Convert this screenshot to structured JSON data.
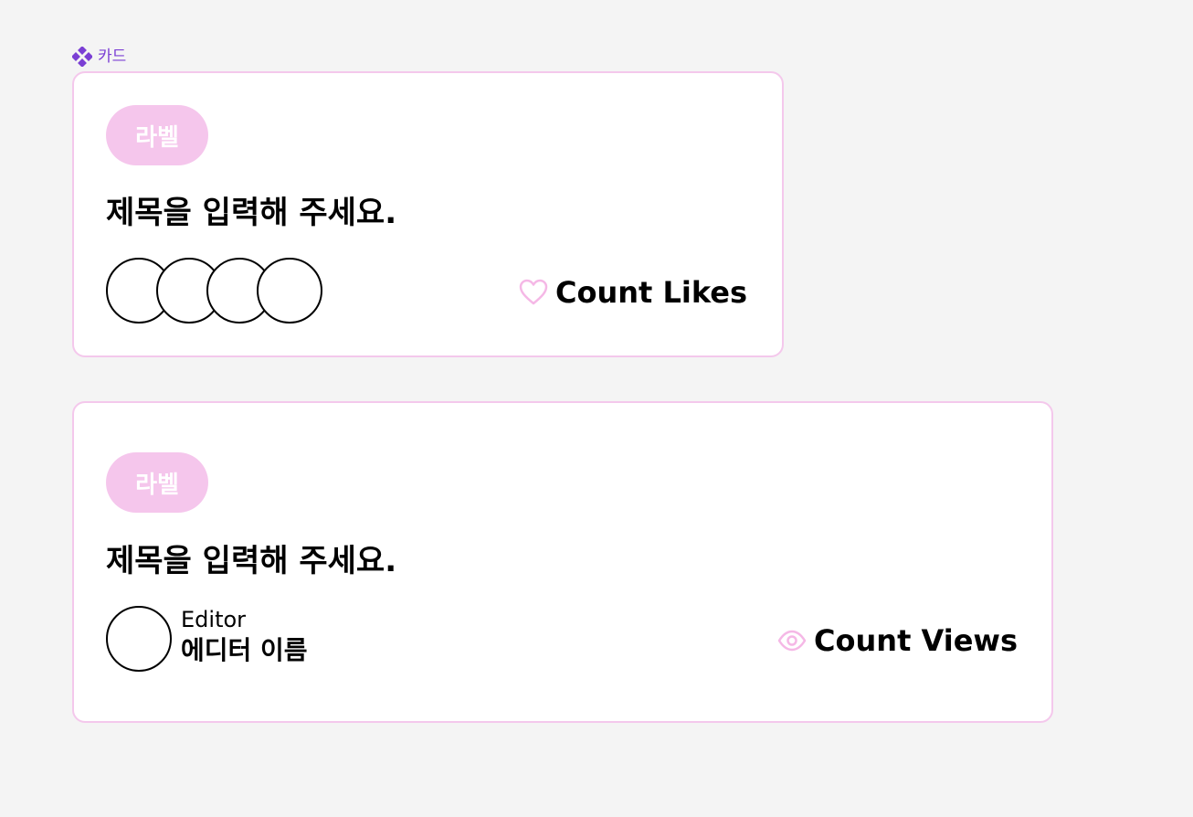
{
  "component": {
    "name": "카드",
    "icon": "component-diamond-icon",
    "color": "#7b3fd4"
  },
  "colors": {
    "accent_pink": "#f5c6ec",
    "card_border": "#f4c8ec",
    "background": "#f4f4f4"
  },
  "cards": [
    {
      "label": "라벨",
      "title": "제목을 입력해 주세요.",
      "avatars": [
        "",
        "",
        "",
        ""
      ],
      "stat": {
        "icon": "heart-icon",
        "text": "Count Likes"
      }
    },
    {
      "label": "라벨",
      "title": "제목을 입력해 주세요.",
      "editor": {
        "role": "Editor",
        "name": "에디터 이름"
      },
      "stat": {
        "icon": "eye-icon",
        "text": "Count Views"
      }
    }
  ]
}
